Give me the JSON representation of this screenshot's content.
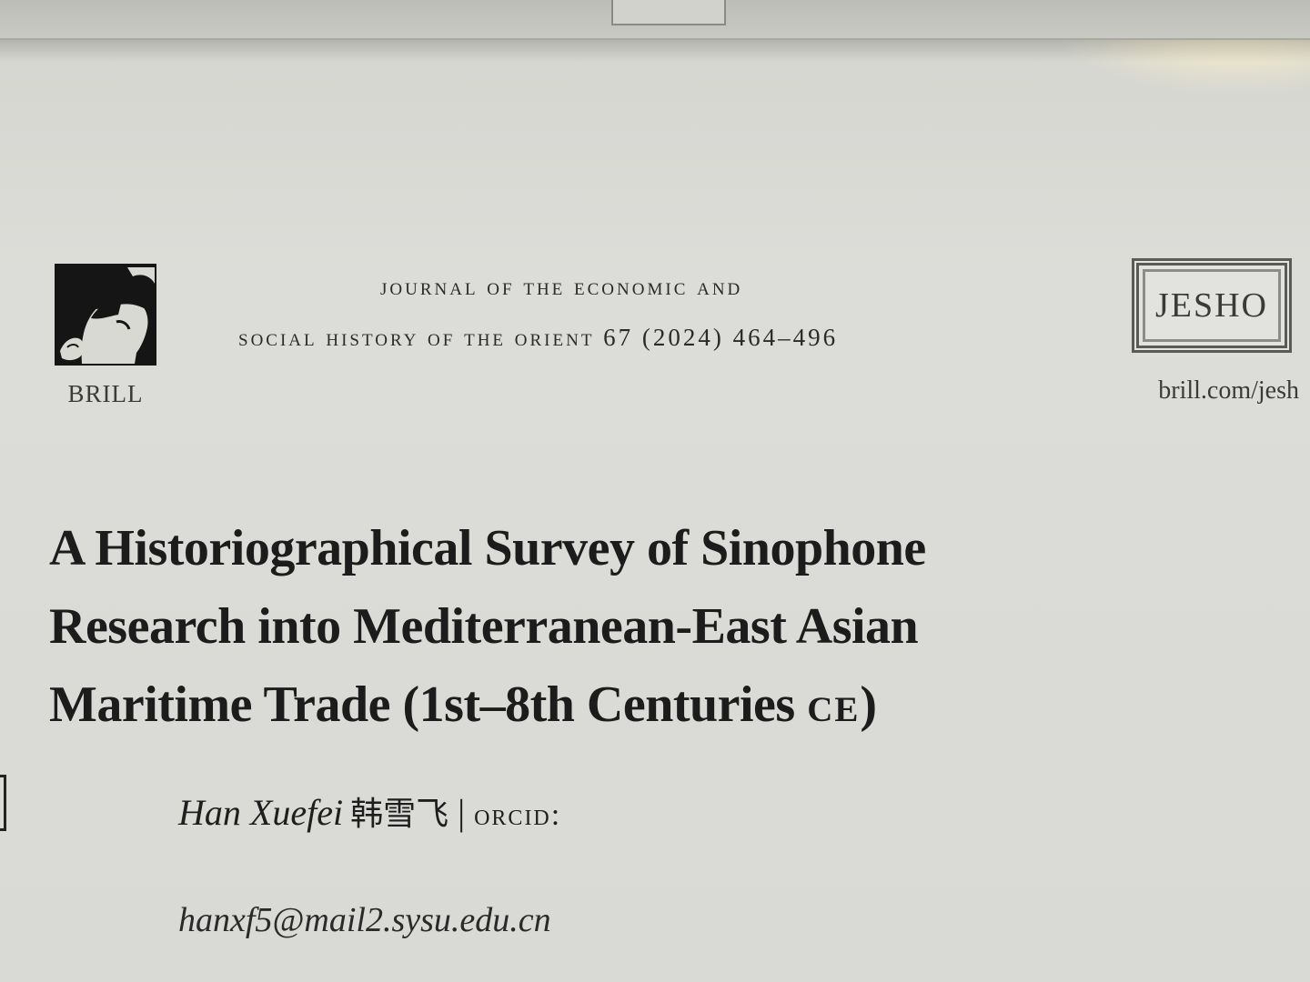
{
  "header": {
    "publisher_name": "BRILL",
    "journal_title_line1": "JOURNAL OF THE ECONOMIC AND",
    "journal_title_line2": "SOCIAL HISTORY OF THE ORIENT 67 (2024) 464–496",
    "journal_badge": "JESHO",
    "journal_url": "brill.com/jesh"
  },
  "article": {
    "title_line1": "A Historiographical Survey of Sinophone",
    "title_line2": "Research into Mediterranean-East Asian",
    "title_line3_main": "Maritime Trade (1st–8th Centuries ",
    "title_line3_era": "CE",
    "title_line3_end": ")"
  },
  "author": {
    "name": "Han Xuefei",
    "name_zh": "韩雪飞",
    "separator": "|",
    "orcid_label": "ORCID:",
    "email": "hanxf5@mail2.sysu.edu.cn"
  },
  "icons": {
    "publisher_logo": "brill-logo-icon"
  }
}
